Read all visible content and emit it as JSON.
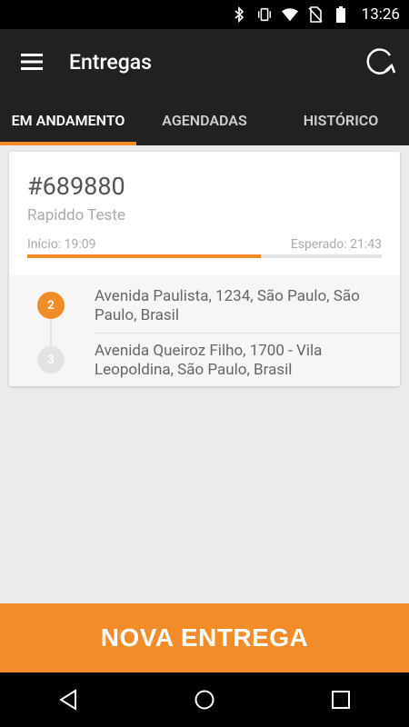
{
  "status_bar": {
    "time": "13:26",
    "icons": [
      "bluetooth-icon",
      "vibrate-icon",
      "wifi-icon",
      "no-sim-icon",
      "battery-icon"
    ]
  },
  "app_bar": {
    "title": "Entregas",
    "icons": [
      "menu-icon",
      "refresh-icon"
    ]
  },
  "tabs": [
    {
      "label": "EM ANDAMENTO",
      "active": true
    },
    {
      "label": "AGENDADAS",
      "active": false
    },
    {
      "label": "HISTÓRICO",
      "active": false
    }
  ],
  "card": {
    "order_id": "#689880",
    "store": "Rapiddo Teste",
    "start_label": "Início: 19:09",
    "expected_label": "Esperado: 21:43",
    "progress_fraction": 0.66,
    "stops": [
      {
        "number": "2",
        "address": "Avenida Paulista, 1234, São Paulo, São Paulo, Brasil",
        "state": "active"
      },
      {
        "number": "3",
        "address": "Avenida Queiroz Filho, 1700 - Vila Leopoldina, São Paulo, Brasil",
        "state": "pending"
      }
    ]
  },
  "cta": {
    "label": "NOVA ENTREGA"
  },
  "nav_bar": {
    "icons": [
      "back-icon",
      "home-icon",
      "recents-icon"
    ]
  },
  "colors": {
    "accent": "#f28c28",
    "app_bar": "#212121",
    "pending_stop": "#e3e3e3"
  }
}
